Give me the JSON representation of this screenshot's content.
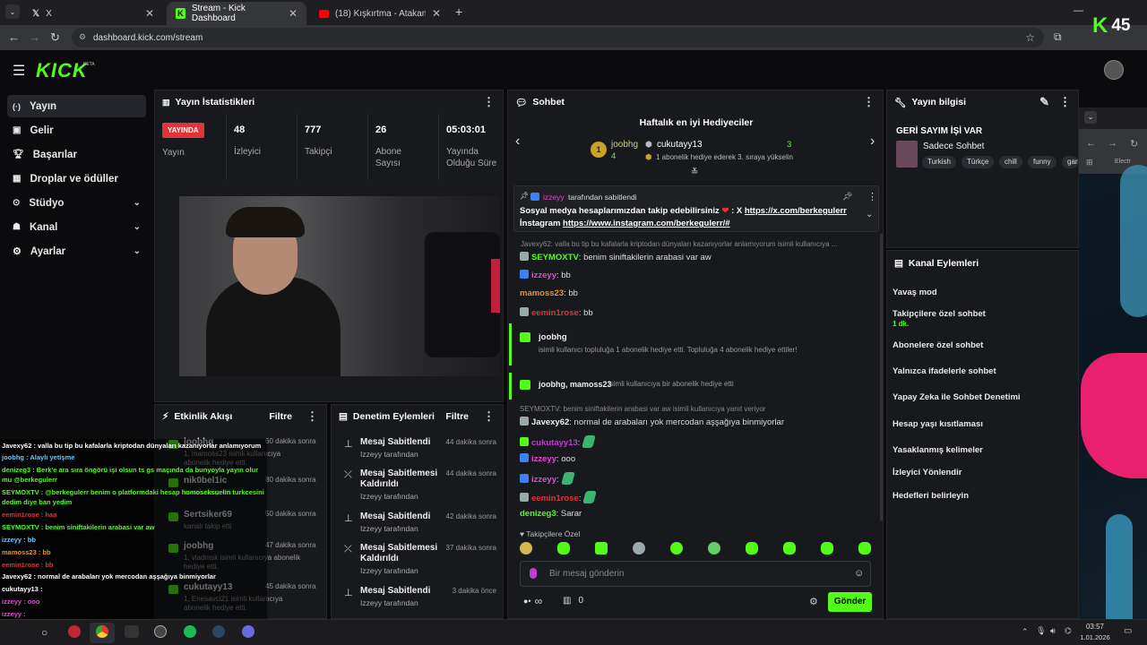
{
  "browser": {
    "tabs": [
      {
        "label": "X"
      },
      {
        "label": "Stream - Kick Dashboard"
      },
      {
        "label": "(18) Kışkırtma - Atakan' Kaçırdı"
      }
    ],
    "url": "dashboard.kick.com/stream"
  },
  "overlay_logo": {
    "letter": "K",
    "count": "45"
  },
  "kick": {
    "logo": "KICK",
    "beta": "BETA"
  },
  "sidebar": {
    "items": [
      {
        "label": "Yayın"
      },
      {
        "label": "Gelir"
      },
      {
        "label": "Başarılar"
      },
      {
        "label": "Droplar ve ödüller"
      },
      {
        "label": "Stüdyo"
      },
      {
        "label": "Kanal"
      },
      {
        "label": "Ayarlar"
      }
    ]
  },
  "stats": {
    "title": "Yayın İstatistikleri",
    "live_badge": "YAYINDA",
    "live_label": "Yayın",
    "items": [
      {
        "value": "48",
        "label": "İzleyici"
      },
      {
        "value": "777",
        "label": "Takipçi"
      },
      {
        "value": "26",
        "label": "Abone Sayısı"
      },
      {
        "value": "05:03:01",
        "label": "Yayında Olduğu Süre"
      }
    ]
  },
  "activity": {
    "title": "Etkinlik Akışı",
    "filter": "Filtre",
    "items": [
      {
        "name": "joobhg",
        "detail": "1, mamoss23 isimli kullanıcıya abonelik hediye etti.",
        "time": "60 dakika sonra"
      },
      {
        "name": "nik0bel1ic",
        "detail": "kanalı takip etti",
        "time": "80 dakika sonra"
      },
      {
        "name": "Sertsiker69",
        "detail": "kanalı takip etti",
        "time": "50 dakika sonra"
      },
      {
        "name": "joobhg",
        "detail": "1, vladmsk isimli kullanıcıya abonelik hediye etti.",
        "time": "47 dakika sonra"
      },
      {
        "name": "cukutayy13",
        "detail": "1, Enesavci21 isimli kullanıcıya abonelik hediye etti.",
        "time": "45 dakika sonra"
      }
    ]
  },
  "moderation": {
    "title": "Denetim Eylemleri",
    "filter": "Filtre",
    "items": [
      {
        "action": "Mesaj Sabitlendi",
        "by": "Izzeyy tarafından",
        "time": "44 dakika sonra"
      },
      {
        "action": "Mesaj Sabitlemesi Kaldırıldı",
        "by": "Izzeyy tarafından",
        "time": "44 dakika sonra"
      },
      {
        "action": "Mesaj Sabitlendi",
        "by": "Izzeyy tarafından",
        "time": "42 dakika sonra"
      },
      {
        "action": "Mesaj Sabitlemesi Kaldırıldı",
        "by": "Izzeyy tarafından",
        "time": "37 dakika sonra"
      },
      {
        "action": "Mesaj Sabitlendi",
        "by": "Izzeyy tarafından",
        "time": "3 dakika önce"
      }
    ]
  },
  "chat": {
    "title": "Sohbet",
    "gifters_title": "Haftalık en iyi Hediyeciler",
    "gifter1": {
      "rank": "1",
      "name": "joobhg",
      "count": "4"
    },
    "gifter2": {
      "name": "cukutayy13",
      "count": "3",
      "note": "1 abonelik hediye ederek 3. sıraya yükselin"
    },
    "pinned": {
      "by_user": "izzeyy",
      "by_suffix": "tarafından sabitlendi",
      "text1": "Sosyal medya hesaplarımızdan takip edebilirsiniz",
      "text1b": ": X",
      "link1": "https://x.com/berkegulerr",
      "text2": "İnstagram",
      "link2": "https://www.instagram.com/berkegulerr/#"
    },
    "reply1": "Javexy62: valla bu tip bu kafalarla kriptodan dünyaları kazanıyorlar anlamıyorum isimli kullanıcıya ...",
    "messages": [
      {
        "user": "SEYMOXTV",
        "text": ": benim siniftakilerin arabasi var aw"
      },
      {
        "user": "izzeyy",
        "text": ": bb"
      },
      {
        "user": "mamoss23",
        "text": ": bb"
      },
      {
        "user": "eemin1rose",
        "text": ": bb"
      }
    ],
    "gift1": {
      "user": "joobhg",
      "text": "isimli kullanıcı topluluğa 1 abonelik hediye etti. Topluluğa 4 abonelik hediye ettiler!"
    },
    "gift2": {
      "users": "joobhg, mamoss23",
      "text": "isimli kullanıcıya bir abonelik hediye etti"
    },
    "reply2": "SEYMOXTV: benim siniftakilerin arabasi var aw isimli kullanıcıya yanıt veriyor",
    "messages2": [
      {
        "user": "Javexy62",
        "text": ": normal de arabaları yok mercodan aşşağıya binmiyorlar"
      },
      {
        "user": "cukutayy13",
        "text": ":"
      },
      {
        "user": "izzeyy",
        "text": ": ooo"
      },
      {
        "user": "izzeyy",
        "text": ":"
      },
      {
        "user": "eemin1rose",
        "text": ":"
      },
      {
        "user": "denizeg3",
        "text": ": Sarar"
      }
    ],
    "followers_only": "Takipçilere Özel",
    "input_placeholder": "Bir mesaj gönderin",
    "infinity": "∞",
    "points": "0",
    "send": "Gönder"
  },
  "stream_info": {
    "title": "Yayın bilgisi",
    "stream_title": "GERİ SAYIM İŞİ VAR",
    "category": "Sadece Sohbet",
    "tags": [
      "Turkish",
      "Türkçe",
      "chill",
      "funny",
      "gam"
    ]
  },
  "channel_actions": {
    "title": "Kanal Eylemleri",
    "items": [
      {
        "label": "Yavaş mod"
      },
      {
        "label": "Takipçilere özel sohbet",
        "sub": "1 dk."
      },
      {
        "label": "Abonelere özel sohbet"
      },
      {
        "label": "Yalnızca ifadelerle sohbet"
      },
      {
        "label": "Yapay Zeka ile Sohbet Denetimi"
      },
      {
        "label": "Hesap yaşı kısıtlaması"
      },
      {
        "label": "Yasaklanmış kelimeler"
      },
      {
        "label": "İzleyici Yönlendir"
      },
      {
        "label": "Hedefleri belirleyin"
      }
    ]
  },
  "second_window": {
    "tab": "Electr"
  },
  "overlay_chat": [
    "Javexy62 : valla bu tip bu kafalarla kriptodan dünyaları kazanıyorlar anlamıyorum",
    "joobhg : Alaylı yetişme",
    "denizeg3 : Berk'e ara sıra öngörü işi olsun ts gs maçında da bunyoyla yayın olur mu @berkegulerr",
    "SEYMOXTV : @berkegulerr benim o platformdaki hesap homoseksuelin turkcesini dedim diye ban yedim",
    "eemin1rose : haa",
    "SEYMOXTV : benim siniftakilerin arabasi var aw",
    "izzeyy : bb",
    "mamoss23 : bb",
    "eemin1rose : bb",
    "Javexy62 : normal de arabaları yok mercodan aşşağıya binmiyorlar",
    "cukutayy13 :",
    "izzeyy : ooo",
    "izzeyy :",
    "eemin1rose :",
    "denizeg3 : Sarar"
  ],
  "taskbar": {
    "time": "03:57",
    "date": "1.01.2026"
  },
  "colors": {
    "accent": "#53fc18",
    "live": "#e0343a",
    "panel": "#18191d"
  }
}
